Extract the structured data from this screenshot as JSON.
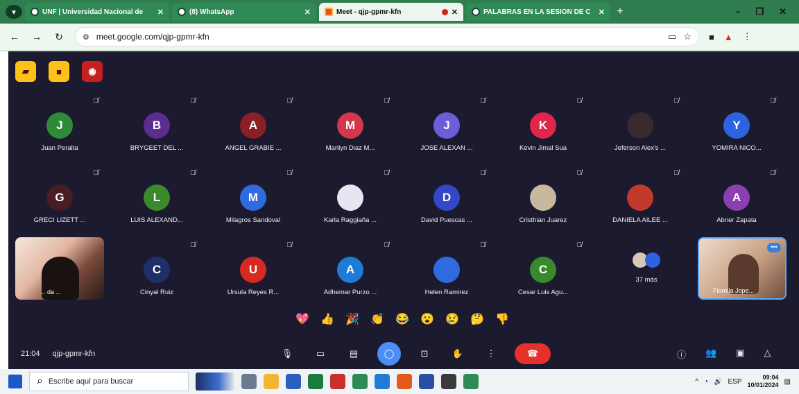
{
  "browser": {
    "tabs": [
      {
        "title": "UNF | Universidad Nacional de",
        "active": false,
        "icon": "globe-icon"
      },
      {
        "title": "(8) WhatsApp",
        "active": false,
        "icon": "whatsapp-icon"
      },
      {
        "title": "Meet - qjp-gpmr-kfn",
        "active": true,
        "icon": "meet-icon",
        "recording": true
      },
      {
        "title": "PALABRAS EN LA SESIÓN DE C",
        "active": false,
        "icon": "globe-icon"
      }
    ],
    "new_tab": "+",
    "url": "meet.google.com/qjp-gpmr-kfn"
  },
  "meet": {
    "participants": [
      {
        "initial": "J",
        "name": "Juan Peralta",
        "color": "#2f8a37"
      },
      {
        "initial": "B",
        "name": "BRYGEET DEL ...",
        "color": "#5b2d8f"
      },
      {
        "initial": "A",
        "name": "ANGEL GRABIE ...",
        "color": "#8a1f28"
      },
      {
        "initial": "M",
        "name": "Marilyn Diaz M...",
        "color": "#d4364b"
      },
      {
        "initial": "J",
        "name": "JOSE ALEXAN ...",
        "color": "#6a5fd8"
      },
      {
        "initial": "K",
        "name": "Kevin Jimal Sua",
        "color": "#e0264a"
      },
      {
        "initial": "",
        "name": "Jeferson Alex's ...",
        "color": "#3a2a2e"
      },
      {
        "initial": "Y",
        "name": "YOMIRA NICO...",
        "color": "#2e63e0"
      },
      {
        "initial": "G",
        "name": "GRECI LIZETT ...",
        "color": "#4a1c24"
      },
      {
        "initial": "L",
        "name": "LUIS ALEXAND...",
        "color": "#3a8a2c"
      },
      {
        "initial": "M",
        "name": "Milagros Sandoval",
        "color": "#2f6bde"
      },
      {
        "initial": "",
        "name": "Karla Raggiaña ...",
        "color": "#e6e6f0"
      },
      {
        "initial": "D",
        "name": "David Puescas ...",
        "color": "#3447c8"
      },
      {
        "initial": "",
        "name": "Cristhian Juarez",
        "color": "#c8b8a0"
      },
      {
        "initial": "",
        "name": "DANIELA AILEE ...",
        "color": "#c23a2a"
      },
      {
        "initial": "A",
        "name": "Abner Zapata",
        "color": "#8c3fb0"
      },
      {
        "initial": "C",
        "name": "Cinyal Ruiz",
        "color": "#1f2f6a"
      },
      {
        "initial": "U",
        "name": "Ursula Reyes R...",
        "color": "#d42a22"
      },
      {
        "initial": "A",
        "name": "Adhemar Purzo ...",
        "color": "#1f7ad8"
      },
      {
        "initial": "",
        "name": "Helen Ramirez",
        "color": "#2f6bde"
      },
      {
        "initial": "C",
        "name": "Cesar Luis Agu...",
        "color": "#3a8a2c"
      }
    ],
    "video_left_name": "... da ...",
    "video_right_name": "Fiorella Jope...",
    "more_count": "37 más",
    "reactions": [
      "💖",
      "👍",
      "🎉",
      "👏",
      "😂",
      "😮",
      "😢",
      "🤔",
      "👎"
    ],
    "time": "21:04",
    "meeting_code": "qjp-gpmr-kfn"
  },
  "taskbar": {
    "search_placeholder": "Escribe aquí para buscar",
    "tray_lang": "ESP",
    "clock_time": "09:04",
    "clock_date": "10/01/2024"
  }
}
